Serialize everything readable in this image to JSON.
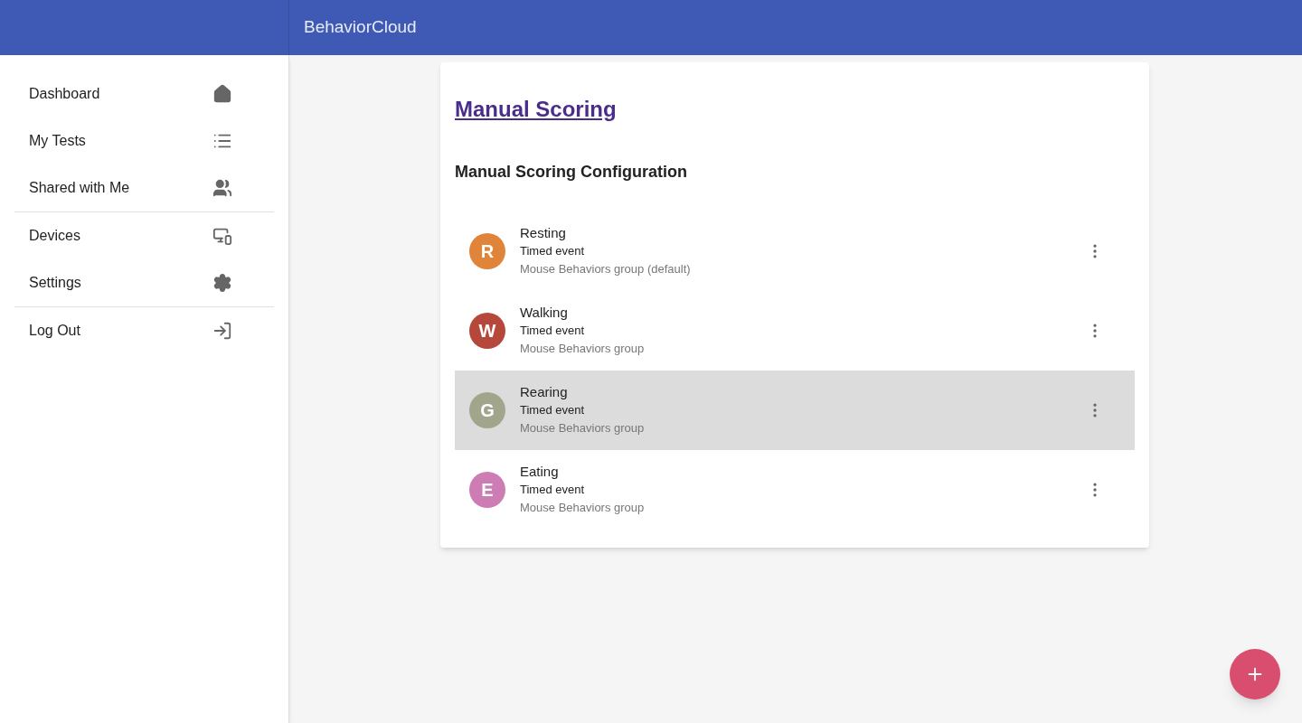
{
  "app_bar": {
    "title": "BehaviorCloud"
  },
  "sidebar": {
    "groups": [
      {
        "items": [
          {
            "label": "Dashboard",
            "kind": "home"
          },
          {
            "label": "My Tests",
            "kind": "list"
          },
          {
            "label": "Shared with Me",
            "kind": "people"
          }
        ]
      },
      {
        "items": [
          {
            "label": "Devices",
            "kind": "devices"
          },
          {
            "label": "Settings",
            "kind": "settings"
          }
        ]
      },
      {
        "items": [
          {
            "label": "Log Out",
            "kind": "logout"
          }
        ]
      }
    ]
  },
  "card": {
    "title": "Manual Scoring",
    "subtitle": "Manual Scoring Configuration",
    "rows": [
      {
        "initial": "R",
        "color": "#e0843a",
        "name": "Resting",
        "type": "Timed event",
        "group": "Mouse Behaviors group (default)",
        "selected": false
      },
      {
        "initial": "W",
        "color": "#b5473b",
        "name": "Walking",
        "type": "Timed event",
        "group": "Mouse Behaviors group",
        "selected": false
      },
      {
        "initial": "G",
        "color": "#a1a58b",
        "name": "Rearing",
        "type": "Timed event",
        "group": "Mouse Behaviors group",
        "selected": true
      },
      {
        "initial": "E",
        "color": "#cd7cb4",
        "name": "Eating",
        "type": "Timed event",
        "group": "Mouse Behaviors group",
        "selected": false
      }
    ]
  },
  "fab": {
    "kind": "add"
  }
}
